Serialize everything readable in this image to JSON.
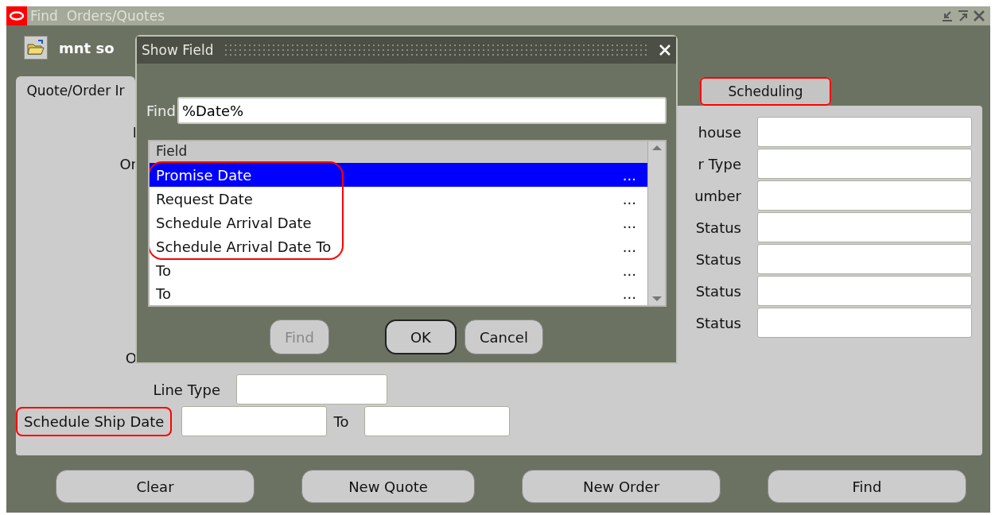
{
  "window": {
    "title": "Find  Orders/Quotes"
  },
  "toolbar": {
    "label": "mnt so"
  },
  "tabs": [
    {
      "label": "Quote/Order Ir",
      "selected": true,
      "highlighted": false
    },
    {
      "label": "Scheduling",
      "selected": false,
      "highlighted": true
    }
  ],
  "left_top_labels": [
    "I",
    "Or"
  ],
  "left_bottom": [
    {
      "kind": "covered",
      "label": "O"
    },
    {
      "kind": "field",
      "label": "Line Type"
    },
    {
      "kind": "range",
      "label": "Schedule Ship Date",
      "to_label": "To",
      "highlighted": true
    }
  ],
  "right_fields": [
    "house",
    "r Type",
    "umber",
    "Status",
    "Status",
    "Status",
    "Status"
  ],
  "buttons": [
    "Clear",
    "New Quote",
    "New Order",
    "Find"
  ],
  "dialog": {
    "title": "Show Field",
    "find_label": "Find",
    "find_value": "%Date%",
    "column": "Field",
    "outlined_rows": [
      {
        "label": "Promise Date",
        "more": "...",
        "selected": true
      },
      {
        "label": "Request Date",
        "more": "...",
        "selected": false
      },
      {
        "label": "Schedule Arrival Date",
        "more": "...",
        "selected": false
      },
      {
        "label": "Schedule Arrival Date To",
        "more": "...",
        "selected": false
      }
    ],
    "rows": [
      {
        "label": "To",
        "more": "...",
        "selected": false
      },
      {
        "label": "To",
        "more": "...",
        "selected": false
      }
    ],
    "buttons": [
      {
        "label": "Find",
        "disabled": true,
        "default": false
      },
      {
        "label": "OK",
        "disabled": false,
        "default": true
      },
      {
        "label": "Cancel",
        "disabled": false,
        "default": false
      }
    ]
  }
}
